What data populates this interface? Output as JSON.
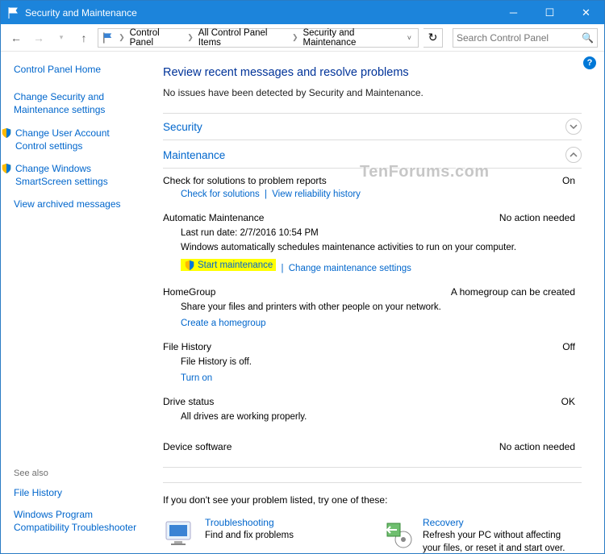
{
  "titlebar": {
    "title": "Security and Maintenance"
  },
  "breadcrumb": {
    "items": [
      "Control Panel",
      "All Control Panel Items",
      "Security and Maintenance"
    ]
  },
  "search": {
    "placeholder": "Search Control Panel"
  },
  "sidebar": {
    "home": "Control Panel Home",
    "links": [
      {
        "label": "Change Security and Maintenance settings",
        "shield": false
      },
      {
        "label": "Change User Account Control settings",
        "shield": true
      },
      {
        "label": "Change Windows SmartScreen settings",
        "shield": true
      },
      {
        "label": "View archived messages",
        "shield": false
      }
    ],
    "see_also": {
      "hdr": "See also",
      "links": [
        "File History",
        "Windows Program Compatibility Troubleshooter"
      ]
    }
  },
  "main": {
    "title": "Review recent messages and resolve problems",
    "subtitle": "No issues have been detected by Security and Maintenance.",
    "security": {
      "name": "Security"
    },
    "maintenance": {
      "name": "Maintenance",
      "solutions": {
        "title": "Check for solutions to problem reports",
        "status": "On",
        "links": [
          "Check for solutions",
          "View reliability history"
        ]
      },
      "auto": {
        "title": "Automatic Maintenance",
        "status": "No action needed",
        "last_run": "Last run date: 2/7/2016 10:54 PM",
        "desc": "Windows automatically schedules maintenance activities to run on your computer.",
        "start": "Start maintenance",
        "change": "Change maintenance settings"
      },
      "homegroup": {
        "title": "HomeGroup",
        "status": "A homegroup can be created",
        "desc": "Share your files and printers with other people on your network.",
        "link": "Create a homegroup"
      },
      "filehistory": {
        "title": "File History",
        "status": "Off",
        "desc": "File History is off.",
        "link": "Turn on"
      },
      "drive": {
        "title": "Drive status",
        "status": "OK",
        "desc": "All drives are working properly."
      },
      "device": {
        "title": "Device software",
        "status": "No action needed"
      }
    },
    "footer": {
      "hint": "If you don't see your problem listed, try one of these:",
      "troubleshoot": {
        "title": "Troubleshooting",
        "desc": "Find and fix problems"
      },
      "recovery": {
        "title": "Recovery",
        "desc": "Refresh your PC without affecting your files, or reset it and start over."
      }
    }
  },
  "watermark": "TenForums.com"
}
